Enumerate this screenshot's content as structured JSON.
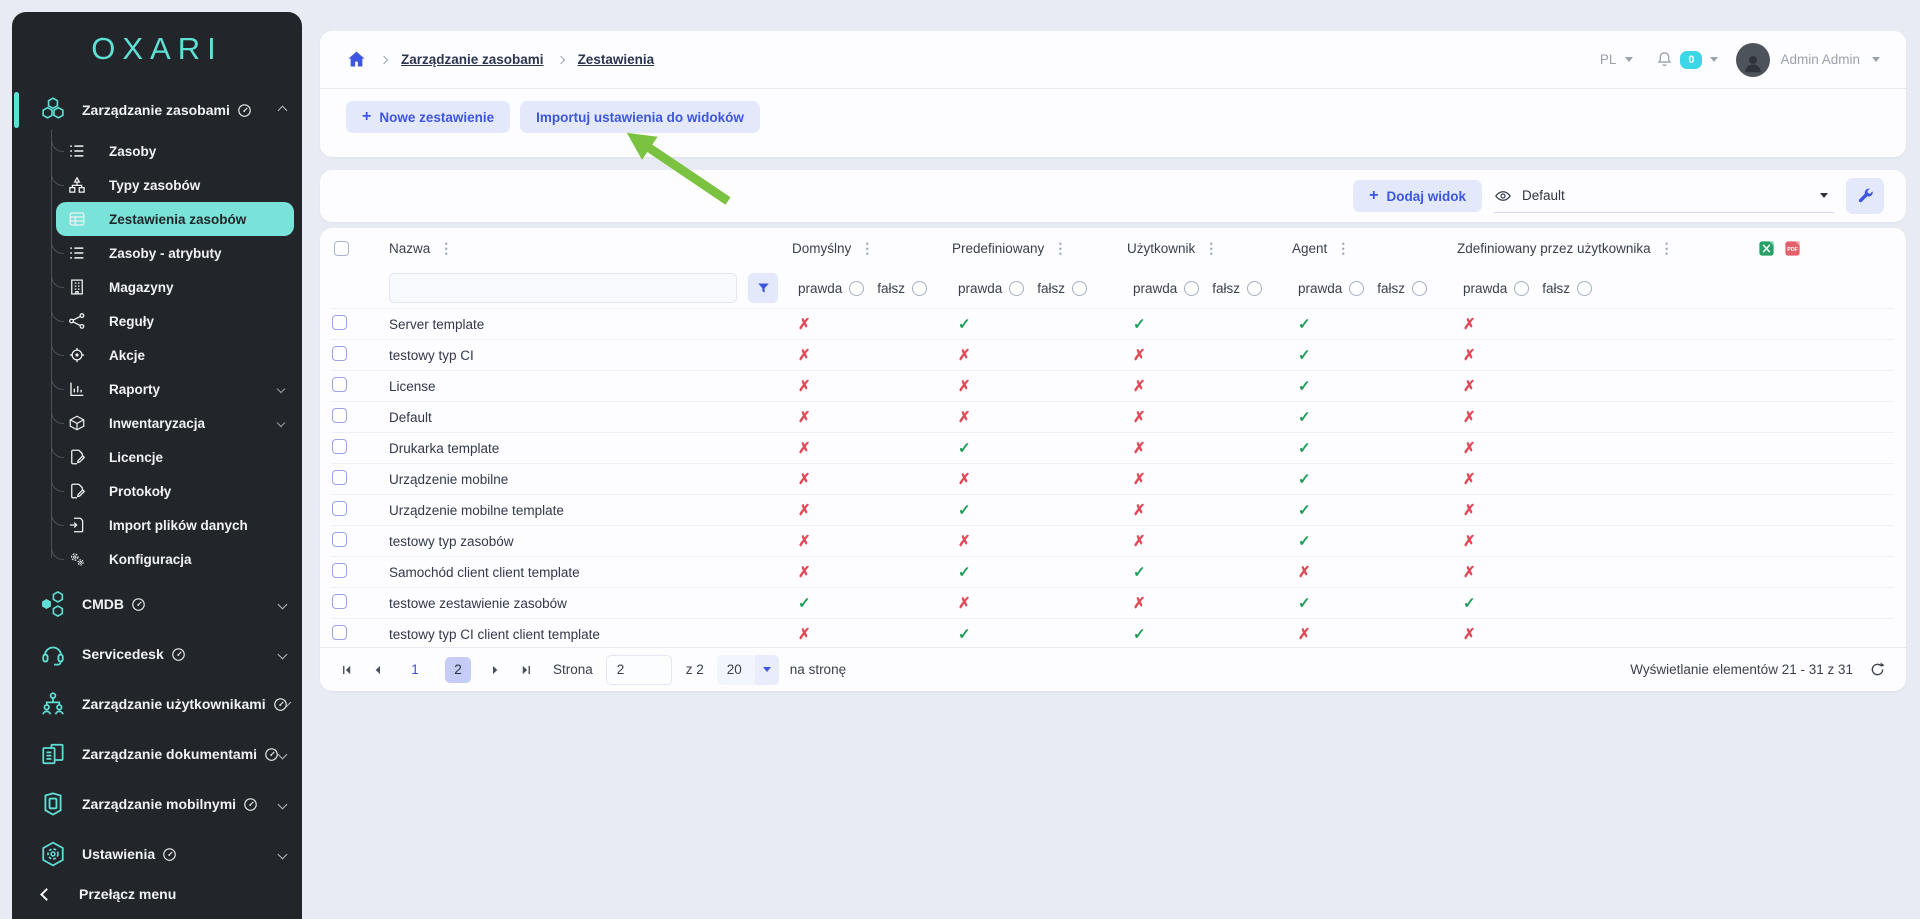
{
  "theme": {
    "accent_blue": "#3d56e0",
    "teal": "#5fe0d4",
    "active_item_bg": "#79e3d9",
    "success_green": "#1f9d57",
    "danger_red": "#e14b58",
    "badge_cyan": "#3bd7e6",
    "arrow_green": "#7cc241",
    "sidebar_bg": "#22262b",
    "page_bg": "#e9ebf4"
  },
  "ui": {
    "plus_glyph": "+",
    "column_menu_glyph": "⋮",
    "check_glyph": "✓",
    "cross_glyph": "✗"
  },
  "sidebar": {
    "logo": "OXARI",
    "sections": [
      {
        "label": "Zarządzanie zasobami",
        "expanded": true,
        "children": [
          {
            "label": "Zasoby"
          },
          {
            "label": "Typy zasobów"
          },
          {
            "label": "Zestawienia zasobów",
            "active": true
          },
          {
            "label": "Zasoby - atrybuty"
          },
          {
            "label": "Magazyny"
          },
          {
            "label": "Reguły"
          },
          {
            "label": "Akcje"
          },
          {
            "label": "Raporty"
          },
          {
            "label": "Inwentaryzacja"
          },
          {
            "label": "Licencje"
          },
          {
            "label": "Protokoły"
          },
          {
            "label": "Import plików danych"
          },
          {
            "label": "Konfiguracja"
          }
        ]
      },
      {
        "label": "CMDB"
      },
      {
        "label": "Servicedesk"
      },
      {
        "label": "Zarządzanie użytkownikami"
      },
      {
        "label": "Zarządzanie dokumentami"
      },
      {
        "label": "Zarządzanie mobilnymi"
      },
      {
        "label": "Ustawienia"
      }
    ],
    "toggle_label": "Przełącz menu"
  },
  "topbar": {
    "language": "PL",
    "notifications": "0",
    "user": "Admin Admin"
  },
  "breadcrumb": {
    "items": [
      "Zarządzanie zasobami",
      "Zestawienia"
    ]
  },
  "page_actions": {
    "new_label": "Nowe zestawienie",
    "import_label": "Importuj ustawienia do widoków"
  },
  "view_toolbar": {
    "add_view_label": "Dodaj widok",
    "selected_view": "Default"
  },
  "table": {
    "columns": [
      "Nazwa",
      "Domyślny",
      "Predefiniowany",
      "Użytkownik",
      "Agent",
      "Zdefiniowany przez użytkownika"
    ],
    "filter": {
      "name_value": "",
      "true_label": "prawda",
      "false_label": "fałsz"
    },
    "rows": [
      {
        "name": "Server template",
        "flags": [
          false,
          true,
          true,
          true,
          false
        ]
      },
      {
        "name": "testowy typ CI",
        "flags": [
          false,
          false,
          false,
          true,
          false
        ]
      },
      {
        "name": "License",
        "flags": [
          false,
          false,
          false,
          true,
          false
        ]
      },
      {
        "name": "Default",
        "flags": [
          false,
          false,
          false,
          true,
          false
        ]
      },
      {
        "name": "Drukarka template",
        "flags": [
          false,
          true,
          false,
          true,
          false
        ]
      },
      {
        "name": "Urządzenie mobilne",
        "flags": [
          false,
          false,
          false,
          true,
          false
        ]
      },
      {
        "name": "Urządzenie mobilne template",
        "flags": [
          false,
          true,
          false,
          true,
          false
        ]
      },
      {
        "name": "testowy typ zasobów",
        "flags": [
          false,
          false,
          false,
          true,
          false
        ]
      },
      {
        "name": "Samochód client client template",
        "flags": [
          false,
          true,
          true,
          false,
          false
        ]
      },
      {
        "name": "testowe zestawienie zasobów",
        "flags": [
          true,
          false,
          false,
          true,
          true
        ]
      },
      {
        "name": "testowy typ CI client client template",
        "flags": [
          false,
          true,
          true,
          false,
          false
        ]
      }
    ]
  },
  "pagination": {
    "pages": [
      "1",
      "2"
    ],
    "current_page": "2",
    "strona_label": "Strona",
    "page_input_value": "2",
    "of_label": "z 2",
    "per_page_value": "20",
    "per_page_label": "na stronę",
    "summary": "Wyświetlanie elementów 21 - 31 z 31"
  }
}
